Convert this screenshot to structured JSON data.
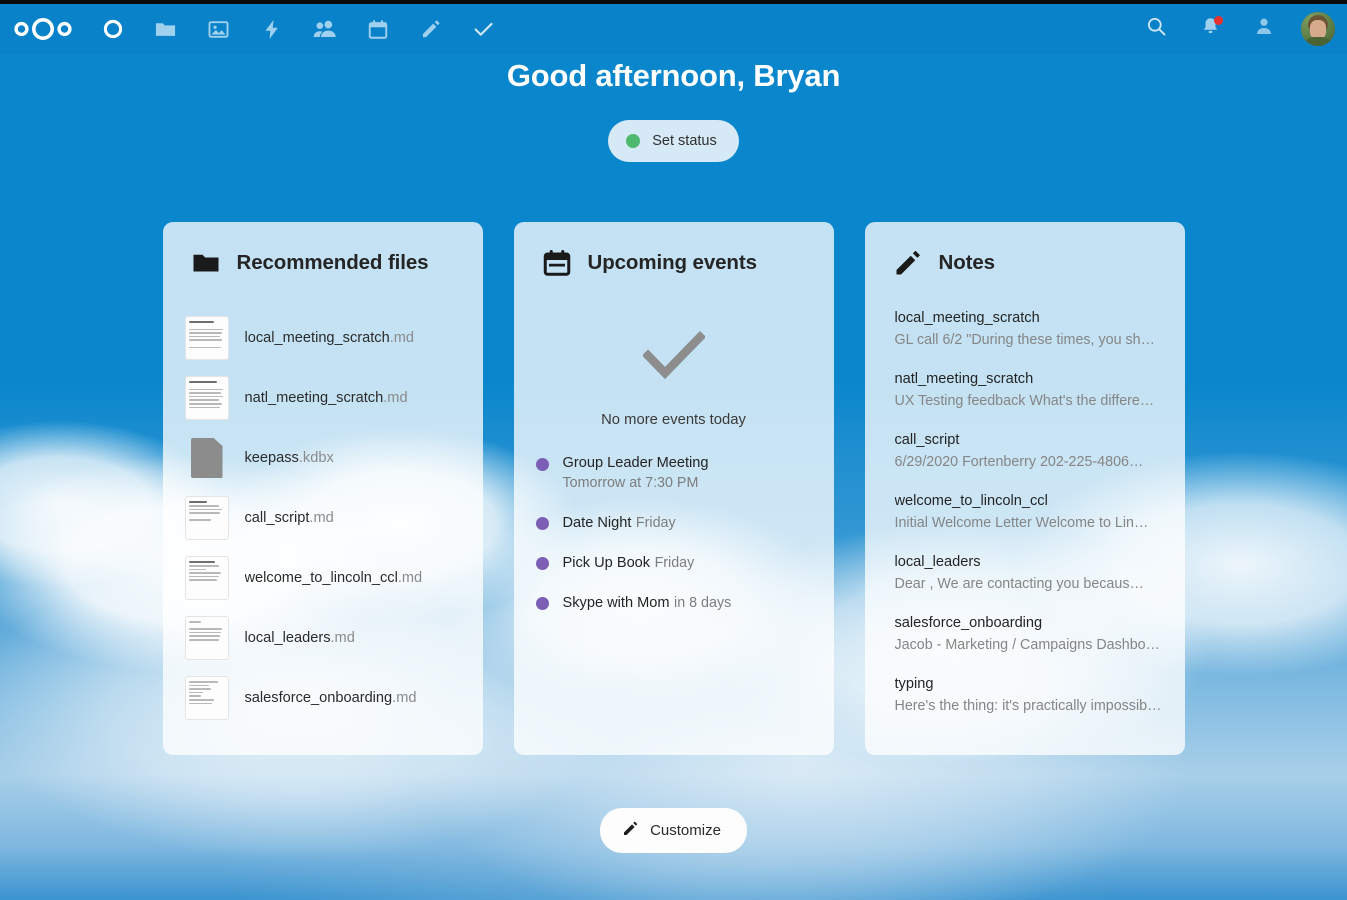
{
  "app": {
    "name": "Nextcloud",
    "accent_color": "#0982c9",
    "panel_color": "#d2e4f3"
  },
  "topbar": {
    "logo": "nextcloud-logo",
    "nav_items": [
      {
        "name": "dashboard",
        "label": "Dashboard",
        "icon": "circle-outline-icon",
        "active": true
      },
      {
        "name": "files",
        "label": "Files",
        "icon": "folder-icon",
        "active": false
      },
      {
        "name": "photos",
        "label": "Photos",
        "icon": "image-icon",
        "active": false
      },
      {
        "name": "activity",
        "label": "Activity",
        "icon": "lightning-bolt-icon",
        "active": false
      },
      {
        "name": "contacts",
        "label": "Contacts",
        "icon": "people-icon",
        "active": false
      },
      {
        "name": "calendar",
        "label": "Calendar",
        "icon": "calendar-icon",
        "active": false
      },
      {
        "name": "notes",
        "label": "Notes",
        "icon": "pencil-icon",
        "active": false
      },
      {
        "name": "tasks",
        "label": "Tasks",
        "icon": "checkmark-icon",
        "active": false
      }
    ],
    "right_items": [
      {
        "name": "search",
        "label": "Search",
        "icon": "search-icon",
        "badge": false
      },
      {
        "name": "notifications",
        "label": "Notifications",
        "icon": "bell-icon",
        "badge": true,
        "badge_color": "#e9322d"
      },
      {
        "name": "contacts-menu",
        "label": "Contacts",
        "icon": "contacts-person-icon",
        "badge": false
      }
    ],
    "avatar": {
      "name": "user-avatar",
      "alt": "Bryan"
    }
  },
  "greeting": {
    "text": "Good afternoon, Bryan"
  },
  "status": {
    "label": "Set status",
    "dot_color": "#4fb96f"
  },
  "panels": {
    "files": {
      "title": "Recommended files",
      "icon": "folder-icon",
      "items": [
        {
          "base": "local_meeting_scratch",
          "ext": ".md",
          "thumb": "text-preview"
        },
        {
          "base": "natl_meeting_scratch",
          "ext": ".md",
          "thumb": "text-preview"
        },
        {
          "base": "keepass",
          "ext": ".kdbx",
          "thumb": "generic-file"
        },
        {
          "base": "call_script",
          "ext": ".md",
          "thumb": "text-preview"
        },
        {
          "base": "welcome_to_lincoln_ccl",
          "ext": ".md",
          "thumb": "text-preview"
        },
        {
          "base": "local_leaders",
          "ext": ".md",
          "thumb": "text-preview"
        },
        {
          "base": "salesforce_onboarding",
          "ext": ".md",
          "thumb": "text-preview"
        }
      ]
    },
    "events": {
      "title": "Upcoming events",
      "icon": "calendar-icon",
      "empty_icon": "checkmark-icon",
      "empty_text": "No more events today",
      "dot_color": "#7c5fb5",
      "items": [
        {
          "title": "Group Leader Meeting",
          "when": "Tomorrow at 7:30 PM"
        },
        {
          "title": "Date Night",
          "when": "Friday"
        },
        {
          "title": "Pick Up Book",
          "when": "Friday"
        },
        {
          "title": "Skype with Mom",
          "when": "in 8 days"
        }
      ]
    },
    "notes": {
      "title": "Notes",
      "icon": "pencil-icon",
      "items": [
        {
          "title": "local_meeting_scratch",
          "snippet": "GL call 6/2    \"During these times, you sh…"
        },
        {
          "title": "natl_meeting_scratch",
          "snippet": "UX Testing feedback    What's the differe…"
        },
        {
          "title": "call_script",
          "snippet": "6/29/2020    Fortenberry 202-225-4806…"
        },
        {
          "title": "welcome_to_lincoln_ccl",
          "snippet": "Initial Welcome Letter    Welcome to Lin…"
        },
        {
          "title": "local_leaders",
          "snippet": "Dear ,      We are contacting you becaus…"
        },
        {
          "title": "salesforce_onboarding",
          "snippet": "Jacob - Marketing / Campaigns    Dashbo…"
        },
        {
          "title": "typing",
          "snippet": "Here's the thing: it's practically impossib…"
        }
      ]
    }
  },
  "customize": {
    "label": "Customize",
    "icon": "pencil-icon"
  }
}
